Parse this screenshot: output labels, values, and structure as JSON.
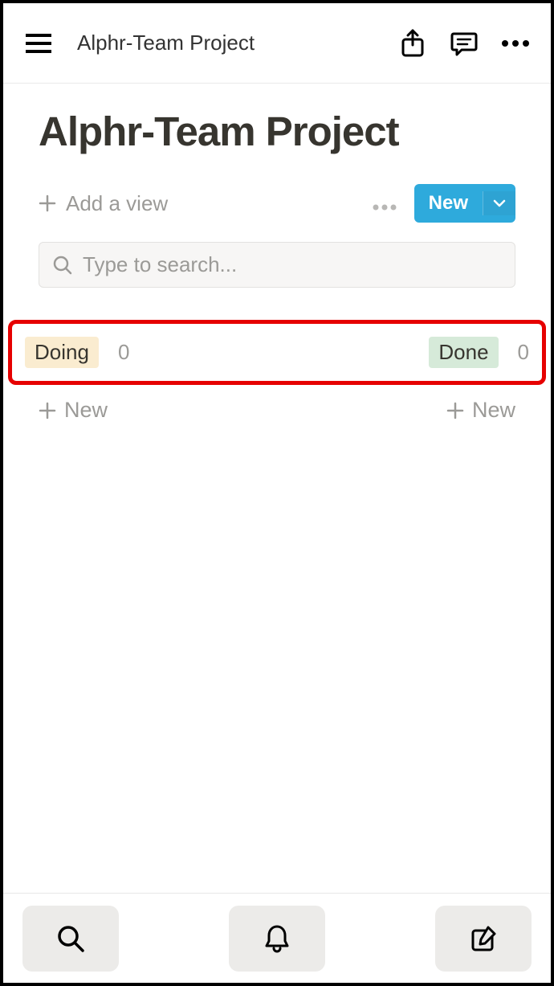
{
  "header": {
    "title": "Alphr-Team Project"
  },
  "page": {
    "title": "Alphr-Team Project",
    "add_view_label": "Add a view",
    "new_button_label": "New"
  },
  "search": {
    "placeholder": "Type to search..."
  },
  "board": {
    "columns": [
      {
        "label": "Doing",
        "count": "0",
        "tag_class": "tag-doing"
      },
      {
        "label": "Done",
        "count": "0",
        "tag_class": "tag-done"
      }
    ],
    "new_card_label": "New"
  }
}
